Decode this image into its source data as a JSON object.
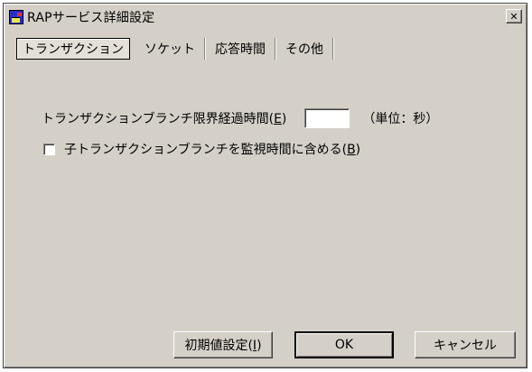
{
  "window": {
    "title": "RAPサービス詳細設定",
    "close_label": "✕"
  },
  "tabs": [
    {
      "label": "トランザクション",
      "active": true
    },
    {
      "label": "ソケット",
      "active": false
    },
    {
      "label": "応答時間",
      "active": false
    },
    {
      "label": "その他",
      "active": false
    }
  ],
  "transaction": {
    "branch_time_label": "トランザクションブランチ限界経過時間",
    "branch_time_mnemonic": "E",
    "branch_time_value": "",
    "unit_label": "（単位：秒）",
    "include_child_label": "子トランザクションブランチを監視時間に含める",
    "include_child_mnemonic": "B",
    "include_child_checked": false
  },
  "buttons": {
    "defaults_label": "初期値設定",
    "defaults_mnemonic": "I",
    "ok_label": "OK",
    "cancel_label": "キャンセル"
  }
}
